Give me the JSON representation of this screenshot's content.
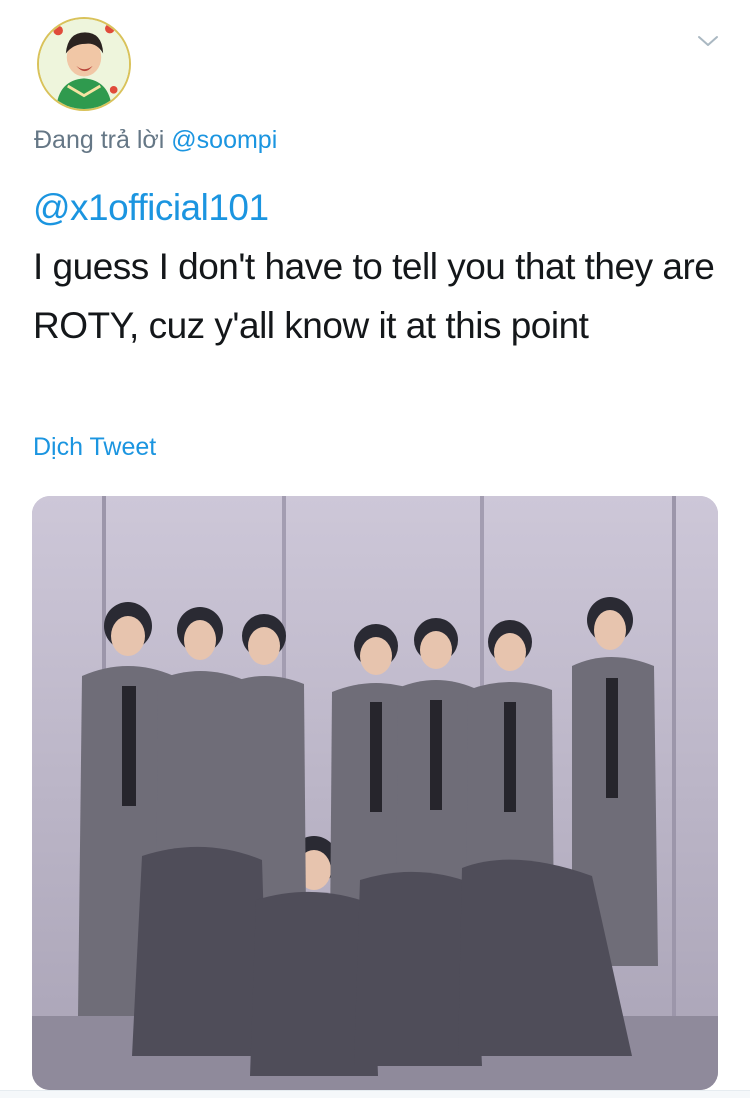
{
  "tweet": {
    "reply_prefix": "Đang trả lời",
    "reply_to": "@soompi",
    "mention": "@x1official101",
    "body": "I guess I don't have to tell you that they are ROTY, cuz y'all know it at this point",
    "translate_label": "Dịch Tweet"
  },
  "icons": {
    "menu": "chevron-down-icon",
    "avatar": "user-avatar",
    "photo": "group-photo"
  },
  "colors": {
    "link": "#1b95e0",
    "secondary_text": "#657786",
    "primary_text": "#14171a",
    "photo_wall": "#b9b2c6"
  }
}
